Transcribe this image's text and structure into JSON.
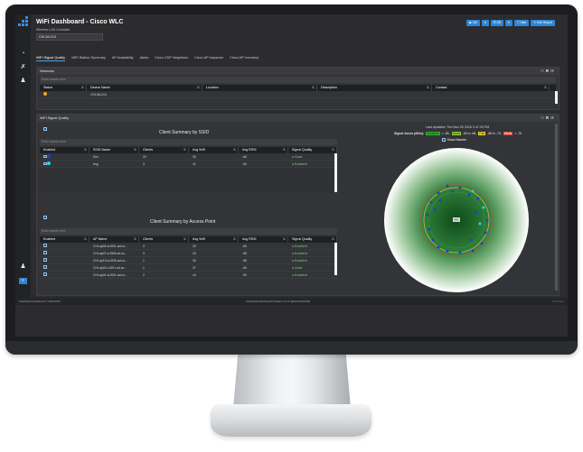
{
  "app": {
    "title": "WiFi Dashboard - Cisco WLC",
    "wlc_label": "Wireless LAN Controller",
    "wlc_value": "CHI-WLC01"
  },
  "top_buttons": [
    "▶ 1W",
    "▾",
    "☰ Off",
    "▾",
    "▽ Hide",
    "✎ Edit Report"
  ],
  "tabs": [
    "WiFi Signal Quality",
    "WiFi Station Summary",
    "AP Availability",
    "Alerts",
    "Cisco CDP Neighbors",
    "Cisco AP Inspector",
    "Cisco AP Inventory"
  ],
  "networks": {
    "title": "Networks",
    "search_placeholder": "Enter search term",
    "columns": [
      "Status",
      "Device Name",
      "Location",
      "Description",
      "Contact"
    ],
    "rows": [
      {
        "status_color": "#f2a81d",
        "device": "CHI-WLC01",
        "location": "",
        "description": "",
        "contact": ""
      }
    ]
  },
  "signal_panel": {
    "title": "WiFi Signal Quality",
    "last_updated": "Last Updated: Thu Nov 03 2016 2:47:20 PM",
    "zones_label": "Signal Zones (dBm):",
    "zones": [
      {
        "label": "Excellent",
        "range": "> -65,",
        "color": "#35b335"
      },
      {
        "label": "Good",
        "range": "-65 to -68,",
        "color": "#8fd13f"
      },
      {
        "label": "Fair",
        "range": "-68 to -75,",
        "color": "#e8d235"
      },
      {
        "label": "Weak",
        "range": "< -75",
        "color": "#d9433b"
      }
    ],
    "show_names": "Show Names",
    "center_label": "MAC"
  },
  "ssid_summary": {
    "title": "Client Summary by SSID",
    "search_placeholder": "Enter search term",
    "columns": [
      "Enabled",
      "SSID Name",
      "Clients",
      "Avg SnR",
      "Avg RSSI",
      "Signal Quality"
    ],
    "rows": [
      {
        "color": "#1e3fd6",
        "ssid": "Dev",
        "clients": "20",
        "snr": "30",
        "rssi": "-66",
        "quality": "Good"
      },
      {
        "color": "#23d4e6",
        "ssid": "eng",
        "clients": "3",
        "snr": "41",
        "rssi": "-54",
        "quality": "Excellent"
      }
    ]
  },
  "ap_summary": {
    "title": "Client Summary by Access Point",
    "search_placeholder": "Enter search term",
    "columns": [
      "Enabled",
      "AP Name",
      "Clients",
      "Avg SnR",
      "Avg RSSI",
      "Signal Quality"
    ],
    "rows": [
      {
        "ap": "CHI-ap04-w-f001.ad.co...",
        "clients": "3",
        "snr": "30",
        "rssi": "-60",
        "quality": "Excellent"
      },
      {
        "ap": "CHI-ap07-e-f005.ad.co...",
        "clients": "3",
        "snr": "33",
        "rssi": "-58",
        "quality": "Excellent"
      },
      {
        "ap": "CHI-ap10-w-f005.ad.co...",
        "clients": "1",
        "snr": "33",
        "rssi": "-58",
        "quality": "Excellent"
      },
      {
        "ap": "CHI-ap03-c-f001.ad.co...",
        "clients": "1",
        "snr": "37",
        "rssi": "-66",
        "quality": "Good"
      },
      {
        "ap": "CHI-ap01-w-f001.ad.co...",
        "clients": "2",
        "snr": "44",
        "rssi": "-50",
        "quality": "Excellent"
      }
    ]
  },
  "footer": {
    "left": "SolarWinds Dashboard © 2016-2023",
    "center": "SolarWinds Dashboard Software v2.3.0 (Build 20161028)",
    "right": "sWindGen"
  }
}
